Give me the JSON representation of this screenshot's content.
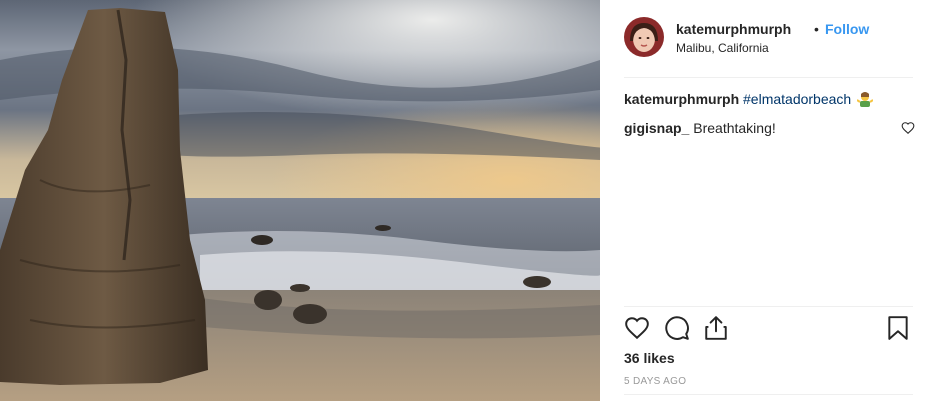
{
  "post": {
    "username": "katemurphmurph",
    "separator": "•",
    "follow_label": "Follow",
    "location": "Malibu, California",
    "likes": "36 likes",
    "timestamp": "5 DAYS AGO"
  },
  "comments": [
    {
      "author": "katemurphmurph",
      "hashtag": "#elmatadorbeach",
      "emoji": "woman-shrugging-emoji"
    },
    {
      "author": "gigisnap_",
      "text": "Breathtaking!"
    }
  ],
  "icons": {
    "like": "heart-icon",
    "comment": "comment-bubble-icon",
    "share": "share-icon",
    "save": "bookmark-icon"
  },
  "colors": {
    "follow": "#3897f0",
    "hashtag": "#003569",
    "divider": "#efefef",
    "muted": "#999999"
  }
}
